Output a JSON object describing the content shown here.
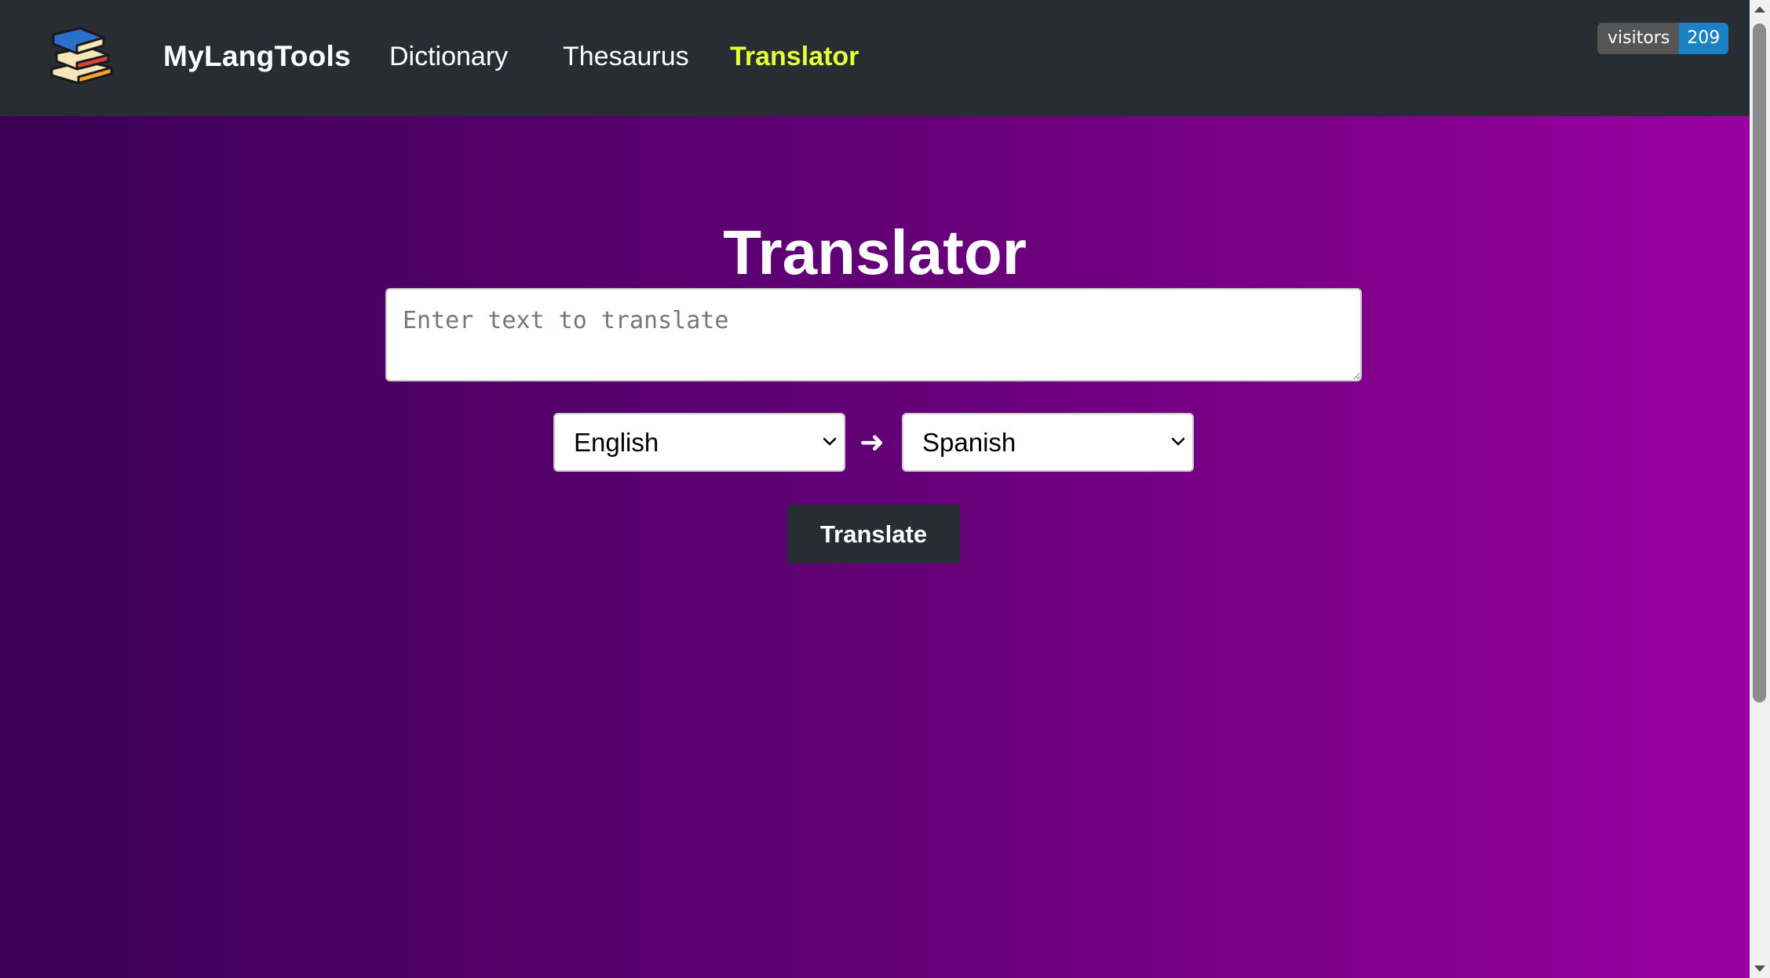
{
  "navbar": {
    "brand": "MyLangTools",
    "links": [
      {
        "label": "Dictionary",
        "active": false
      },
      {
        "label": "Thesaurus",
        "active": false
      },
      {
        "label": "Translator",
        "active": true
      }
    ],
    "visitors_badge": {
      "label": "visitors",
      "count": "209"
    }
  },
  "main": {
    "title": "Translator",
    "input": {
      "placeholder": "Enter text to translate",
      "value": ""
    },
    "source_language": "English",
    "arrow": "➜",
    "target_language": "Spanish",
    "translate_label": "Translate"
  },
  "colors": {
    "navbar_bg": "#282c33",
    "active_link": "#e4ff3a",
    "gradient_start": "#3b0055",
    "gradient_end": "#9c00a3",
    "badge_count_bg": "#1a82c4"
  },
  "icons": [
    "books-logo-icon",
    "chevron-down-icon",
    "right-arrow-icon"
  ]
}
